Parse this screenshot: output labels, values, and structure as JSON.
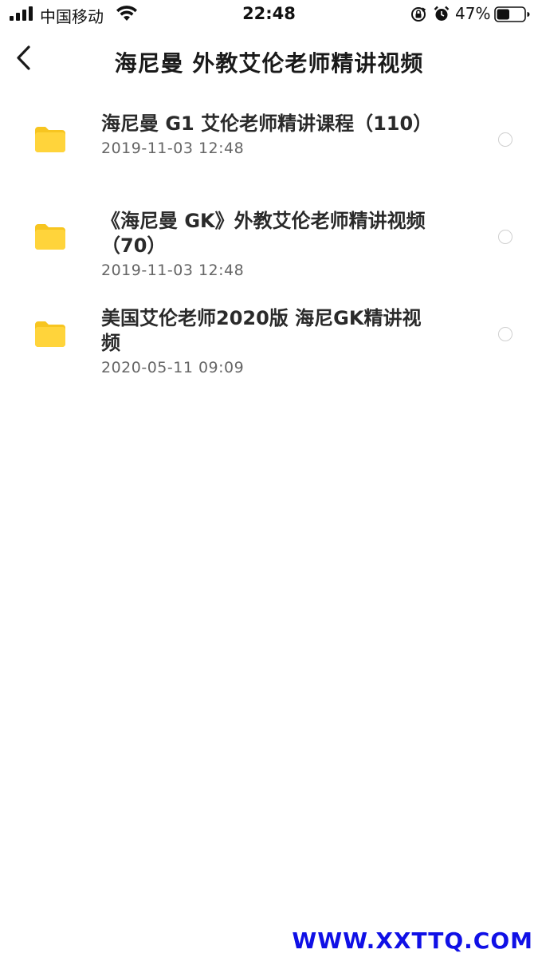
{
  "status_bar": {
    "carrier": "中国移动",
    "time": "22:48",
    "battery_percent": "47%",
    "battery_level": 0.47,
    "icons": [
      "signal-icon",
      "wifi-icon",
      "rotation-lock-icon",
      "alarm-icon",
      "battery-icon"
    ]
  },
  "nav": {
    "title": "海尼曼 外教艾伦老师精讲视频",
    "back_icon": "chevron-left-icon"
  },
  "folders": [
    {
      "name": "海尼曼 G1 艾伦老师精讲课程（110）",
      "date": "2019-11-03 12:48",
      "icon": "folder-icon"
    },
    {
      "name": "《海尼曼 GK》外教艾伦老师精讲视频（70）",
      "date": "2019-11-03 12:48",
      "icon": "folder-icon"
    },
    {
      "name": "美国艾伦老师2020版 海尼GK精讲视频",
      "date": "2020-05-11 09:09",
      "icon": "folder-icon"
    }
  ],
  "colors": {
    "folder": "#FFD43B",
    "folder_tab": "#F7C520",
    "watermark": "#1010E6"
  },
  "watermark": "WWW.XXTTQ.COM"
}
